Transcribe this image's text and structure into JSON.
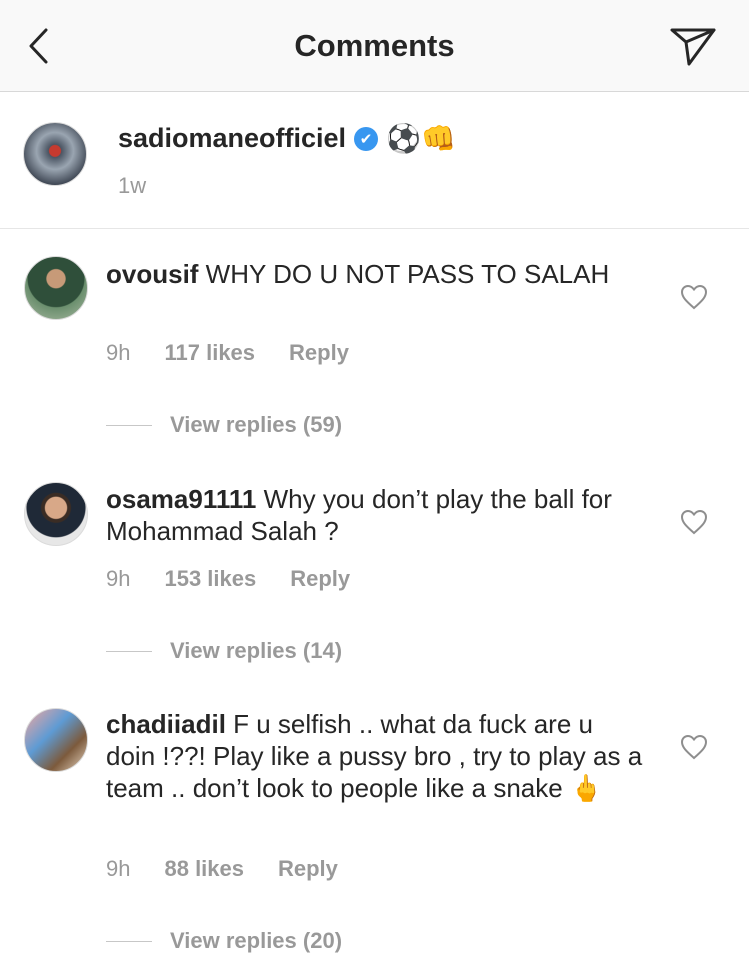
{
  "header": {
    "title": "Comments"
  },
  "caption": {
    "username": "sadiomaneofficiel",
    "verified_mark": "✔",
    "emojis": "⚽👊",
    "time": "1w"
  },
  "comments": [
    {
      "username": "ovousif",
      "text": " WHY DO U NOT PASS TO SALAH",
      "time": "9h",
      "likes": "117 likes",
      "reply": "Reply",
      "view_replies": "View replies (59)"
    },
    {
      "username": "osama91111",
      "text": " Why you don’t play the ball for Mohammad Salah ?",
      "time": "9h",
      "likes": "153 likes",
      "reply": "Reply",
      "view_replies": "View replies (14)"
    },
    {
      "username": "chadiiadil",
      "text": " F u selfish .. what da fuck are u doin !??! Play like a pussy bro , try to play as a team .. don’t look to people like a snake 🖕",
      "time": "9h",
      "likes": "88 likes",
      "reply": "Reply",
      "view_replies": "View replies (20)"
    }
  ],
  "icons": {
    "back": "chevron-left-icon",
    "send": "paper-plane-icon",
    "like": "heart-icon"
  }
}
